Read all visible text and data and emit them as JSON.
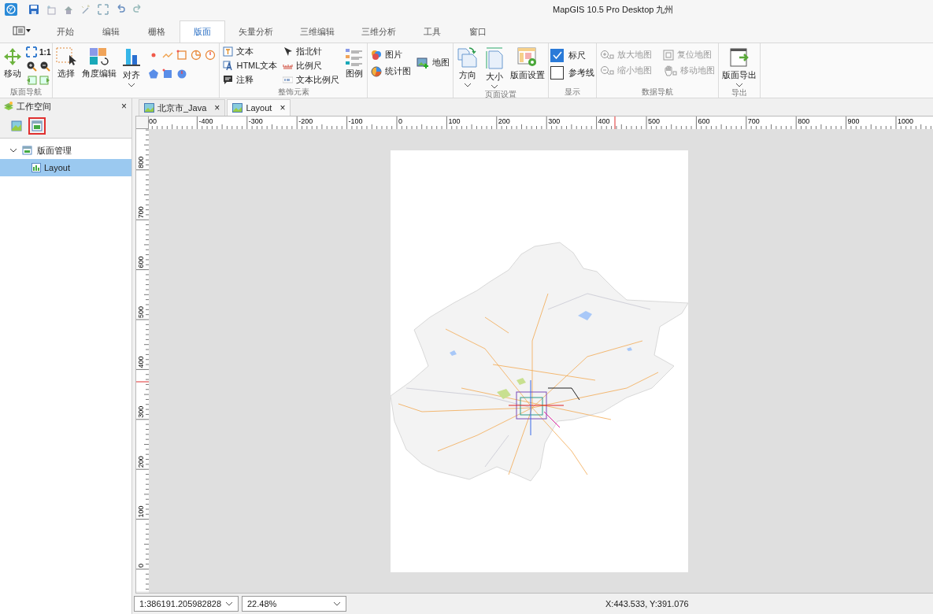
{
  "title_bar": {
    "title": "MapGIS 10.5 Pro Desktop 九州"
  },
  "menu_tabs": [
    {
      "label": "开始",
      "selected": false
    },
    {
      "label": "编辑",
      "selected": false
    },
    {
      "label": "栅格",
      "selected": false
    },
    {
      "label": "版面",
      "selected": true
    },
    {
      "label": "矢量分析",
      "selected": false
    },
    {
      "label": "三维编辑",
      "selected": false
    },
    {
      "label": "三维分析",
      "selected": false
    },
    {
      "label": "工具",
      "selected": false
    },
    {
      "label": "窗口",
      "selected": false
    }
  ],
  "ribbon": {
    "navigation": {
      "group_label": "版面导航",
      "move": "移动",
      "actual_size": "1:1"
    },
    "edit": {
      "select": "选择",
      "angle_edit": "角度编辑",
      "align": "对齐"
    },
    "decoration": {
      "group_label": "整饰元素",
      "items": [
        "文本",
        "HTML文本",
        "注释",
        "指北针",
        "比例尺",
        "文本比例尺"
      ],
      "legend": "图例"
    },
    "insert": {
      "items": [
        "图片",
        "统计图"
      ],
      "map": "地图"
    },
    "page_setup": {
      "group_label": "页面设置",
      "orientation": "方向",
      "size": "大小",
      "settings": "版面设置"
    },
    "display": {
      "group_label": "显示",
      "options": [
        {
          "label": "标尺",
          "checked": true
        },
        {
          "label": "参考线",
          "checked": false
        }
      ]
    },
    "data_navigation": {
      "group_label": "数据导航",
      "items": [
        {
          "label": "放大地图",
          "disabled": true
        },
        {
          "label": "缩小地图",
          "disabled": true
        },
        {
          "label": "复位地图",
          "disabled": true
        },
        {
          "label": "移动地图",
          "disabled": true
        }
      ]
    },
    "export": {
      "group_label": "导出",
      "export": "版面导出"
    }
  },
  "workspace": {
    "title": "工作空间",
    "close": "×",
    "views": [
      {
        "selected": false
      },
      {
        "selected": true
      }
    ],
    "tree": [
      {
        "label": "版面管理",
        "expanded": true,
        "children": [
          {
            "label": "Layout",
            "selected": true
          }
        ]
      }
    ]
  },
  "doc_tabs": [
    {
      "label": "北京市_Java",
      "close": "×",
      "selected": false
    },
    {
      "label": "Layout",
      "close": "×",
      "selected": true
    }
  ],
  "rulers": {
    "horizontal": [
      "00",
      "-400",
      "-300",
      "-200",
      "-100",
      "0",
      "100",
      "200",
      "300",
      "400",
      "500",
      "600",
      "700",
      "800",
      "900",
      "1000"
    ],
    "vertical": [
      "800",
      "700",
      "600",
      "500",
      "400",
      "300",
      "200",
      "100",
      "0"
    ]
  },
  "status_bar": {
    "scale": "1:386191.205982828",
    "zoom": "22.48%",
    "coordinates": "X:443.533, Y:391.076"
  }
}
